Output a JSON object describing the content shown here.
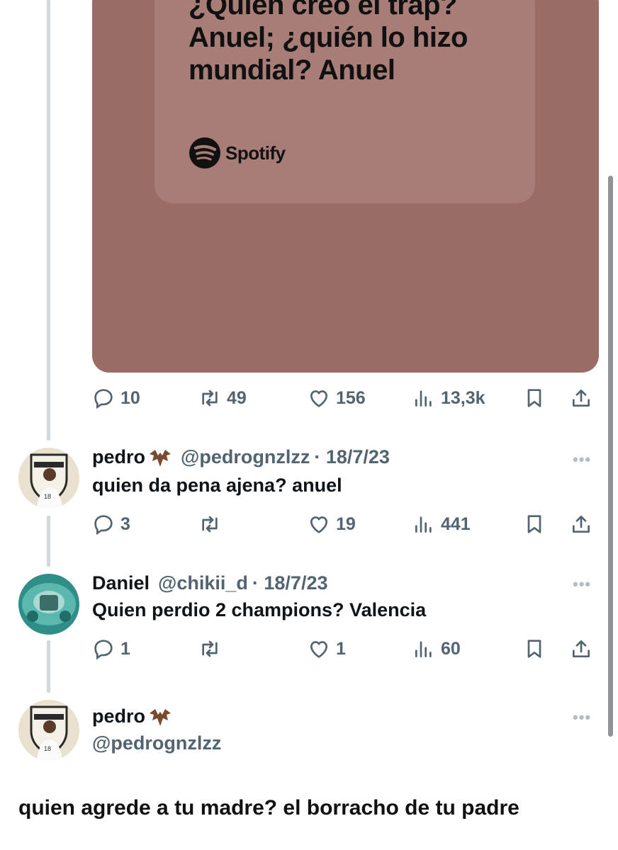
{
  "card": {
    "lyrics": [
      "¿Quién creó el trap?",
      "Anuel; ¿quién lo hizo",
      "mundial? Anuel"
    ],
    "brand": "Spotify"
  },
  "main_actions": {
    "replies": "10",
    "reposts": "49",
    "likes": "156",
    "views": "13,3k"
  },
  "replies": [
    {
      "name": "pedro",
      "handle": "@pedrognzlzz",
      "date": "· 18/7/23",
      "text": "quien da pena ajena? anuel",
      "more": "•••",
      "actions": {
        "replies": "3",
        "reposts": "",
        "likes": "19",
        "views": "441"
      }
    },
    {
      "name": "Daniel",
      "handle": "@chikii_d",
      "date": "· 18/7/23",
      "text": "Quien perdio 2 champions? Valencia",
      "more": "•••",
      "actions": {
        "replies": "1",
        "reposts": "",
        "likes": "1",
        "views": "60"
      }
    },
    {
      "name": "pedro",
      "handle": "@pedrognzlzz",
      "more": "•••"
    }
  ],
  "composer_caption": "quien agrede a tu madre? el borracho de tu padre",
  "colors": {
    "card_outer": "#9b6c66",
    "card_inner": "#a97d77",
    "icon_gray": "#536471",
    "thread_line": "#cfd9de"
  },
  "icons": [
    "reply-icon",
    "repost-icon",
    "like-icon",
    "views-icon",
    "bookmark-icon",
    "share-icon",
    "bat-emoji-icon",
    "spotify-logo-icon"
  ]
}
